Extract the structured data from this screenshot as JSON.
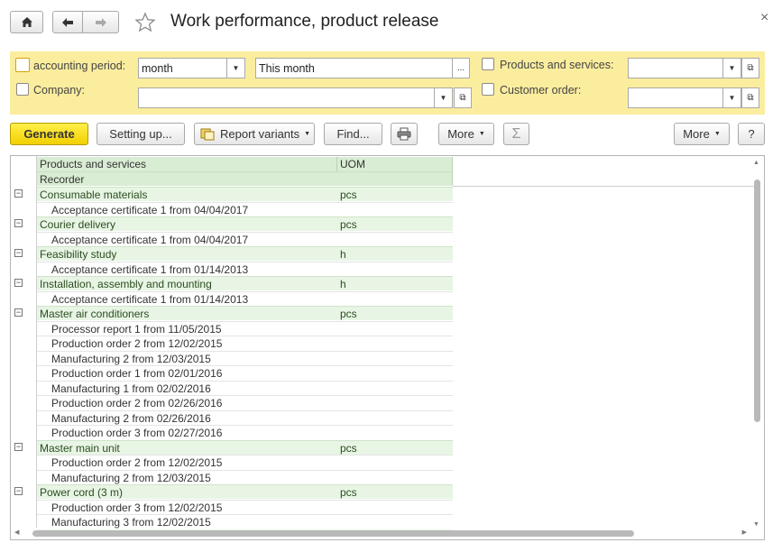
{
  "window": {
    "title": "Work performance, product release",
    "close_glyph": "×"
  },
  "nav": {
    "home_icon": "home-icon",
    "back_icon": "arrow-left-icon",
    "forward_icon": "arrow-right-icon",
    "favorite_icon": "star-icon"
  },
  "filters": {
    "accounting_period_label": "accounting period:",
    "period_type_value": "month",
    "period_value": "This month",
    "period_select_glyph": "...",
    "company_label": "Company:",
    "company_value": "",
    "products_label": "Products and services:",
    "products_value": "",
    "customer_order_label": "Customer order:",
    "customer_order_value": ""
  },
  "toolbar": {
    "generate": "Generate",
    "setting_up": "Setting up...",
    "report_variants": "Report variants",
    "find": "Find...",
    "more_1": "More",
    "sum_glyph": "Σ",
    "more_2": "More",
    "help": "?"
  },
  "table": {
    "headers": {
      "products": "Products and services",
      "uom": "UOM",
      "recorder": "Recorder"
    },
    "rows": [
      {
        "type": "group",
        "name": "Consumable materials",
        "uom": "pcs"
      },
      {
        "type": "detail",
        "name": "Acceptance certificate 1 from 04/04/2017"
      },
      {
        "type": "group",
        "name": "Courier delivery",
        "uom": "pcs"
      },
      {
        "type": "detail",
        "name": "Acceptance certificate 1 from 04/04/2017"
      },
      {
        "type": "group",
        "name": "Feasibility study",
        "uom": "h"
      },
      {
        "type": "detail",
        "name": "Acceptance certificate 1 from 01/14/2013"
      },
      {
        "type": "group",
        "name": "Installation, assembly and mounting",
        "uom": "h"
      },
      {
        "type": "detail",
        "name": "Acceptance certificate 1 from 01/14/2013"
      },
      {
        "type": "group",
        "name": "Master air conditioners",
        "uom": "pcs"
      },
      {
        "type": "detail",
        "name": "Processor report 1 from 11/05/2015"
      },
      {
        "type": "detail",
        "name": "Production order 2 from 12/02/2015"
      },
      {
        "type": "detail",
        "name": "Manufacturing 2 from 12/03/2015"
      },
      {
        "type": "detail",
        "name": "Production order 1 from 02/01/2016"
      },
      {
        "type": "detail",
        "name": "Manufacturing 1 from 02/02/2016"
      },
      {
        "type": "detail",
        "name": "Production order 2 from 02/26/2016"
      },
      {
        "type": "detail",
        "name": "Manufacturing 2 from 02/26/2016"
      },
      {
        "type": "detail",
        "name": "Production order 3 from 02/27/2016"
      },
      {
        "type": "group",
        "name": "Master main unit",
        "uom": "pcs"
      },
      {
        "type": "detail",
        "name": "Production order 2 from 12/02/2015"
      },
      {
        "type": "detail",
        "name": "Manufacturing 2 from 12/03/2015"
      },
      {
        "type": "group",
        "name": "Power cord (3 m)",
        "uom": "pcs"
      },
      {
        "type": "detail",
        "name": "Production order 3 from 12/02/2015"
      },
      {
        "type": "detail",
        "name": "Manufacturing 3 from 12/02/2015"
      }
    ]
  },
  "scroll": {
    "vertical_position": 0.0,
    "horizontal_position": 0.0
  }
}
